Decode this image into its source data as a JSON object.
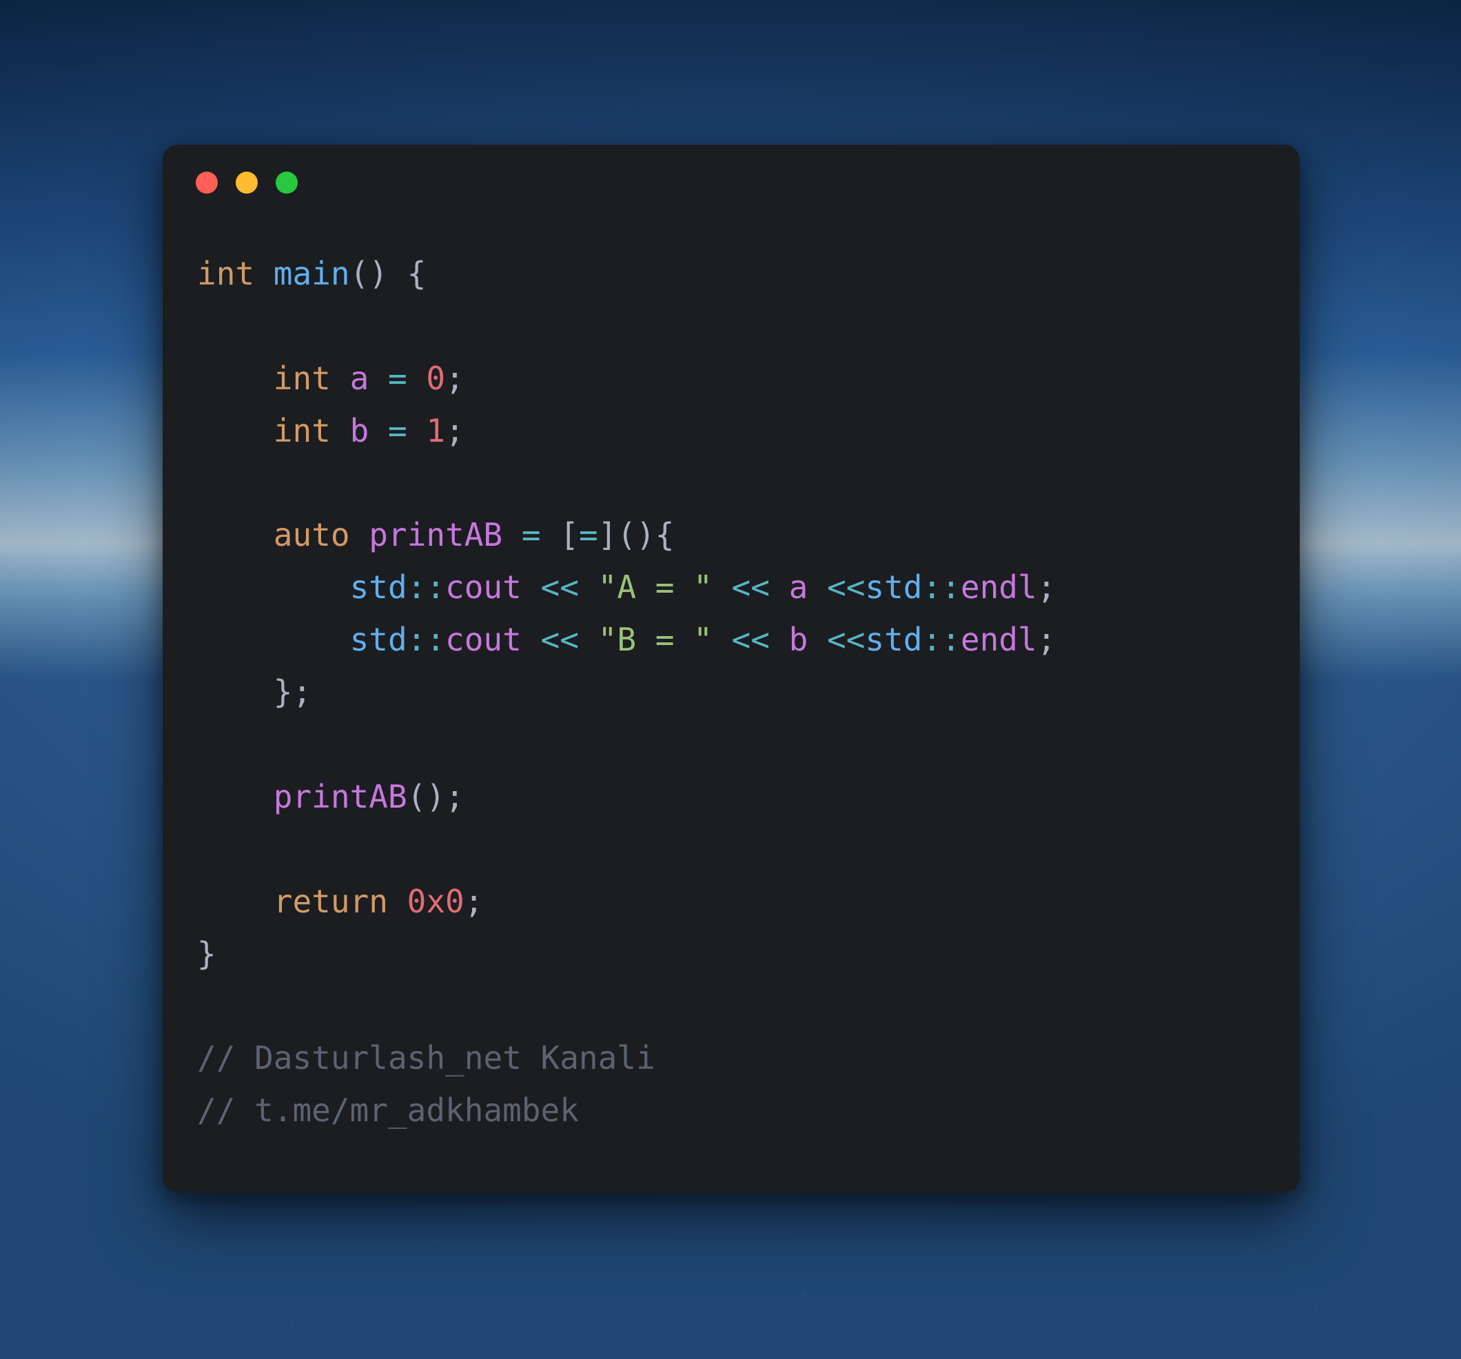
{
  "colors": {
    "window_bg": "#1c1d21",
    "close": "#ff5f57",
    "minimize": "#febc2e",
    "zoom": "#28c840",
    "keyword": "#d19a66",
    "function": "#61afef",
    "identifier": "#c678dd",
    "operator": "#56b6c2",
    "punct": "#abb2bf",
    "number": "#e06c75",
    "string": "#98c379",
    "comment": "#5c6370"
  },
  "code": {
    "language": "cpp",
    "tokens": [
      [
        {
          "c": "key",
          "t": "int"
        },
        {
          "c": "punc",
          "t": " "
        },
        {
          "c": "fn",
          "t": "main"
        },
        {
          "c": "punc",
          "t": "() {"
        }
      ],
      [],
      [
        {
          "c": "punc",
          "t": "    "
        },
        {
          "c": "key",
          "t": "int"
        },
        {
          "c": "punc",
          "t": " "
        },
        {
          "c": "id",
          "t": "a"
        },
        {
          "c": "punc",
          "t": " "
        },
        {
          "c": "op",
          "t": "="
        },
        {
          "c": "punc",
          "t": " "
        },
        {
          "c": "num",
          "t": "0"
        },
        {
          "c": "punc",
          "t": ";"
        }
      ],
      [
        {
          "c": "punc",
          "t": "    "
        },
        {
          "c": "key",
          "t": "int"
        },
        {
          "c": "punc",
          "t": " "
        },
        {
          "c": "id",
          "t": "b"
        },
        {
          "c": "punc",
          "t": " "
        },
        {
          "c": "op",
          "t": "="
        },
        {
          "c": "punc",
          "t": " "
        },
        {
          "c": "num",
          "t": "1"
        },
        {
          "c": "punc",
          "t": ";"
        }
      ],
      [],
      [
        {
          "c": "punc",
          "t": "    "
        },
        {
          "c": "key",
          "t": "auto"
        },
        {
          "c": "punc",
          "t": " "
        },
        {
          "c": "id",
          "t": "printAB"
        },
        {
          "c": "punc",
          "t": " "
        },
        {
          "c": "op",
          "t": "="
        },
        {
          "c": "punc",
          "t": " ["
        },
        {
          "c": "op",
          "t": "="
        },
        {
          "c": "punc",
          "t": "](){"
        }
      ],
      [
        {
          "c": "punc",
          "t": "        "
        },
        {
          "c": "ns",
          "t": "std"
        },
        {
          "c": "op",
          "t": "::"
        },
        {
          "c": "id",
          "t": "cout"
        },
        {
          "c": "punc",
          "t": " "
        },
        {
          "c": "op",
          "t": "<<"
        },
        {
          "c": "punc",
          "t": " "
        },
        {
          "c": "str",
          "t": "\"A = \""
        },
        {
          "c": "punc",
          "t": " "
        },
        {
          "c": "op",
          "t": "<<"
        },
        {
          "c": "punc",
          "t": " "
        },
        {
          "c": "id",
          "t": "a"
        },
        {
          "c": "punc",
          "t": " "
        },
        {
          "c": "op",
          "t": "<<"
        },
        {
          "c": "ns",
          "t": "std"
        },
        {
          "c": "op",
          "t": "::"
        },
        {
          "c": "id",
          "t": "endl"
        },
        {
          "c": "punc",
          "t": ";"
        }
      ],
      [
        {
          "c": "punc",
          "t": "        "
        },
        {
          "c": "ns",
          "t": "std"
        },
        {
          "c": "op",
          "t": "::"
        },
        {
          "c": "id",
          "t": "cout"
        },
        {
          "c": "punc",
          "t": " "
        },
        {
          "c": "op",
          "t": "<<"
        },
        {
          "c": "punc",
          "t": " "
        },
        {
          "c": "str",
          "t": "\"B = \""
        },
        {
          "c": "punc",
          "t": " "
        },
        {
          "c": "op",
          "t": "<<"
        },
        {
          "c": "punc",
          "t": " "
        },
        {
          "c": "id",
          "t": "b"
        },
        {
          "c": "punc",
          "t": " "
        },
        {
          "c": "op",
          "t": "<<"
        },
        {
          "c": "ns",
          "t": "std"
        },
        {
          "c": "op",
          "t": "::"
        },
        {
          "c": "id",
          "t": "endl"
        },
        {
          "c": "punc",
          "t": ";"
        }
      ],
      [
        {
          "c": "punc",
          "t": "    };"
        }
      ],
      [],
      [
        {
          "c": "punc",
          "t": "    "
        },
        {
          "c": "id",
          "t": "printAB"
        },
        {
          "c": "punc",
          "t": "();"
        }
      ],
      [],
      [
        {
          "c": "punc",
          "t": "    "
        },
        {
          "c": "key",
          "t": "return"
        },
        {
          "c": "punc",
          "t": " "
        },
        {
          "c": "num",
          "t": "0x0"
        },
        {
          "c": "punc",
          "t": ";"
        }
      ],
      [
        {
          "c": "punc",
          "t": "}"
        }
      ],
      [],
      [
        {
          "c": "cmt",
          "t": "// Dasturlash_net Kanali"
        }
      ],
      [
        {
          "c": "cmt",
          "t": "// t.me/mr_adkhambek"
        }
      ]
    ]
  }
}
